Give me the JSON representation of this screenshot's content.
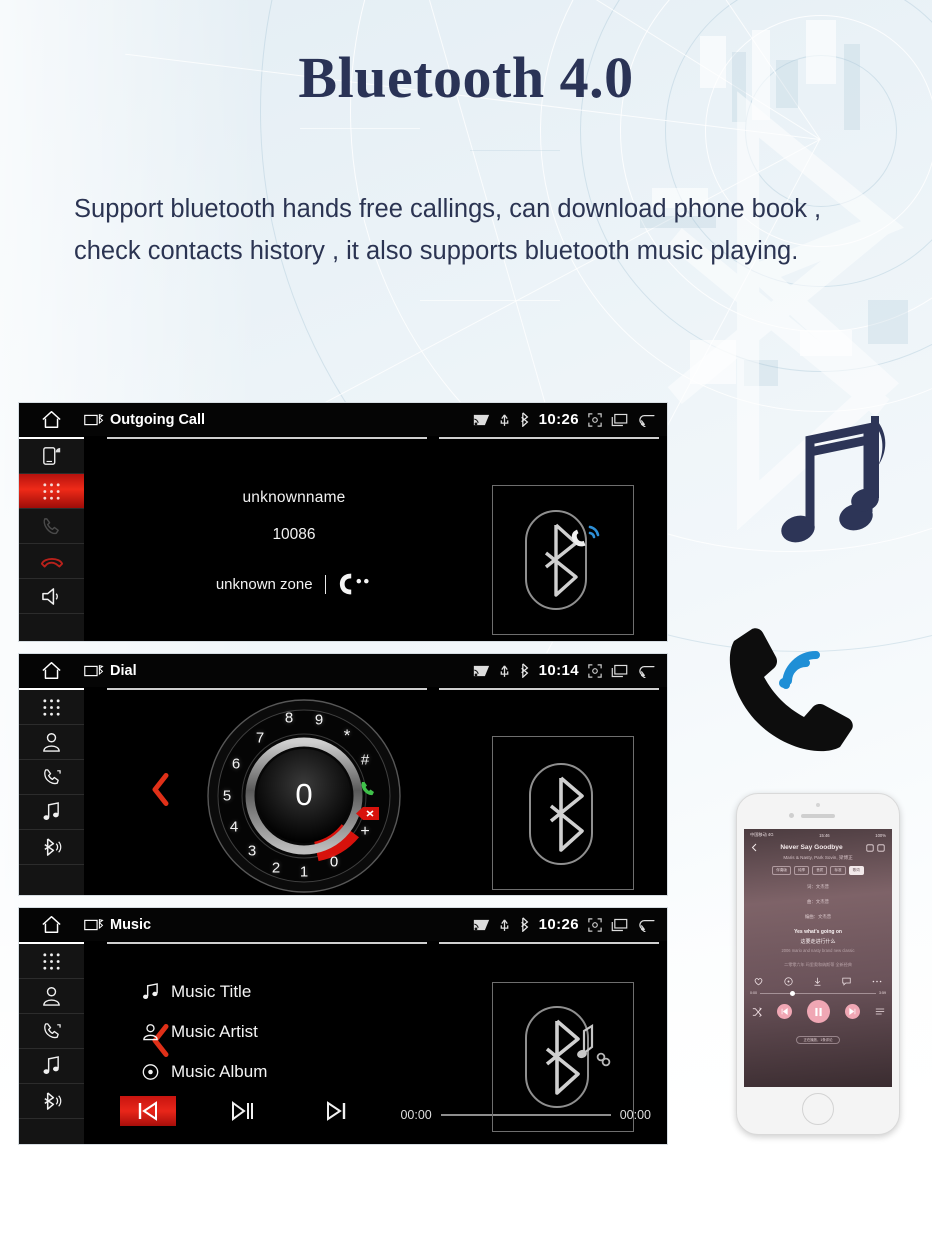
{
  "header": {
    "title": "Bluetooth 4.0",
    "description": "Support bluetooth hands free callings, can download phone book , check contacts history , it also supports bluetooth music playing."
  },
  "colors": {
    "accent_red": "#e8261a",
    "text_navy": "#2b3452",
    "screen_bg": "#000000",
    "bluetooth_blue": "#1f8fd6"
  },
  "screens": [
    {
      "id": "outgoing-call",
      "titlebar": {
        "home_icon": "home-icon",
        "device_icon": "bluetooth-device-icon",
        "title": "Outgoing Call",
        "status_icons": [
          "cast-icon",
          "usb-icon",
          "bluetooth-icon"
        ],
        "clock": "10:26",
        "right_icons": [
          "screenshot-icon",
          "recents-icon",
          "back-icon"
        ]
      },
      "rail": [
        {
          "name": "phone-signal-icon",
          "state": "normal"
        },
        {
          "name": "keypad-icon",
          "state": "active"
        },
        {
          "name": "call-icon",
          "state": "disabled"
        },
        {
          "name": "hangup-icon",
          "state": "red"
        },
        {
          "name": "speaker-icon",
          "state": "normal"
        }
      ],
      "call": {
        "name": "unknownname",
        "number": "10086",
        "zone": "unknown zone",
        "status_icon": "calling-handset-icon"
      },
      "panel_icon": "bluetooth-call-icon"
    },
    {
      "id": "dial",
      "titlebar": {
        "home_icon": "home-icon",
        "device_icon": "bluetooth-device-icon",
        "title": "Dial",
        "status_icons": [
          "cast-icon",
          "usb-icon",
          "bluetooth-icon"
        ],
        "clock": "10:14",
        "right_icons": [
          "screenshot-icon",
          "recents-icon",
          "back-icon"
        ]
      },
      "rail": [
        {
          "name": "keypad-icon",
          "state": "normal"
        },
        {
          "name": "contacts-icon",
          "state": "normal"
        },
        {
          "name": "call-history-icon",
          "state": "normal"
        },
        {
          "name": "music-icon",
          "state": "normal"
        },
        {
          "name": "bluetooth-icon",
          "state": "normal"
        }
      ],
      "dial": {
        "center_value": "0",
        "keys": [
          "8",
          "9",
          "*",
          "#",
          "call",
          "delete",
          "+",
          "0",
          "1",
          "2",
          "3",
          "4",
          "5",
          "6",
          "7"
        ],
        "highlighted_key": "0",
        "call_key_icon": "green-call-icon",
        "delete_key_icon": "backspace-icon"
      },
      "panel_icon": "bluetooth-icon",
      "collapse_icon": "chevron-left-icon"
    },
    {
      "id": "music",
      "titlebar": {
        "home_icon": "home-icon",
        "device_icon": "bluetooth-device-icon",
        "title": "Music",
        "status_icons": [
          "cast-icon",
          "usb-icon",
          "bluetooth-icon"
        ],
        "clock": "10:26",
        "right_icons": [
          "screenshot-icon",
          "recents-icon",
          "back-icon"
        ]
      },
      "rail": [
        {
          "name": "keypad-icon",
          "state": "normal"
        },
        {
          "name": "contacts-icon",
          "state": "normal"
        },
        {
          "name": "call-history-icon",
          "state": "normal"
        },
        {
          "name": "music-icon",
          "state": "normal"
        },
        {
          "name": "bluetooth-icon",
          "state": "normal"
        }
      ],
      "meta": [
        {
          "icon": "music-note-icon",
          "label": "Music Title"
        },
        {
          "icon": "artist-icon",
          "label": "Music Artist"
        },
        {
          "icon": "album-icon",
          "label": "Music Album"
        }
      ],
      "controls": {
        "previous": "previous-track-icon",
        "play_pause": "play-pause-icon",
        "next": "next-track-icon",
        "active": "previous-track-icon"
      },
      "elapsed": "00:00",
      "duration": "00:00",
      "panel_icon": "bluetooth-music-icon",
      "collapse_icon": "chevron-left-icon"
    }
  ],
  "decorations": {
    "music_notes_icon": "music-notes-icon",
    "handset_icon": "phone-handset-icon",
    "signal_icon": "signal-waves-icon"
  },
  "phone_mock": {
    "status_left": "中国移动 4G",
    "status_clock": "15:46",
    "status_right": "100%",
    "song_title": "Never Say Goodbye",
    "artists": "Maris & Nasty, Park Sovin, 梁博正",
    "tags": [
      "伴奏版",
      "纯享",
      "音质",
      "标准",
      "歌词"
    ],
    "info_rows": [
      "词：文杰普",
      "曲：文杰普",
      "编曲：文杰普"
    ],
    "lyric_active": "Yes what's going on",
    "lyric_active_cn": "这要走进行什么",
    "lyric_next": "2006 mario and nasty brand new classic",
    "lyric_next_cn": "二零零六年 玛里奥和纳斯蒂 全新经典",
    "elapsed": "0:00",
    "duration": "3:59",
    "action_icons": [
      "heart-icon",
      "record-icon",
      "download-icon",
      "comment-icon",
      "more-icon"
    ],
    "player_icons": [
      "shuffle-icon",
      "previous-icon",
      "pause-icon",
      "next-icon",
      "playlist-icon"
    ],
    "footer": "正在播放，1条评论"
  }
}
